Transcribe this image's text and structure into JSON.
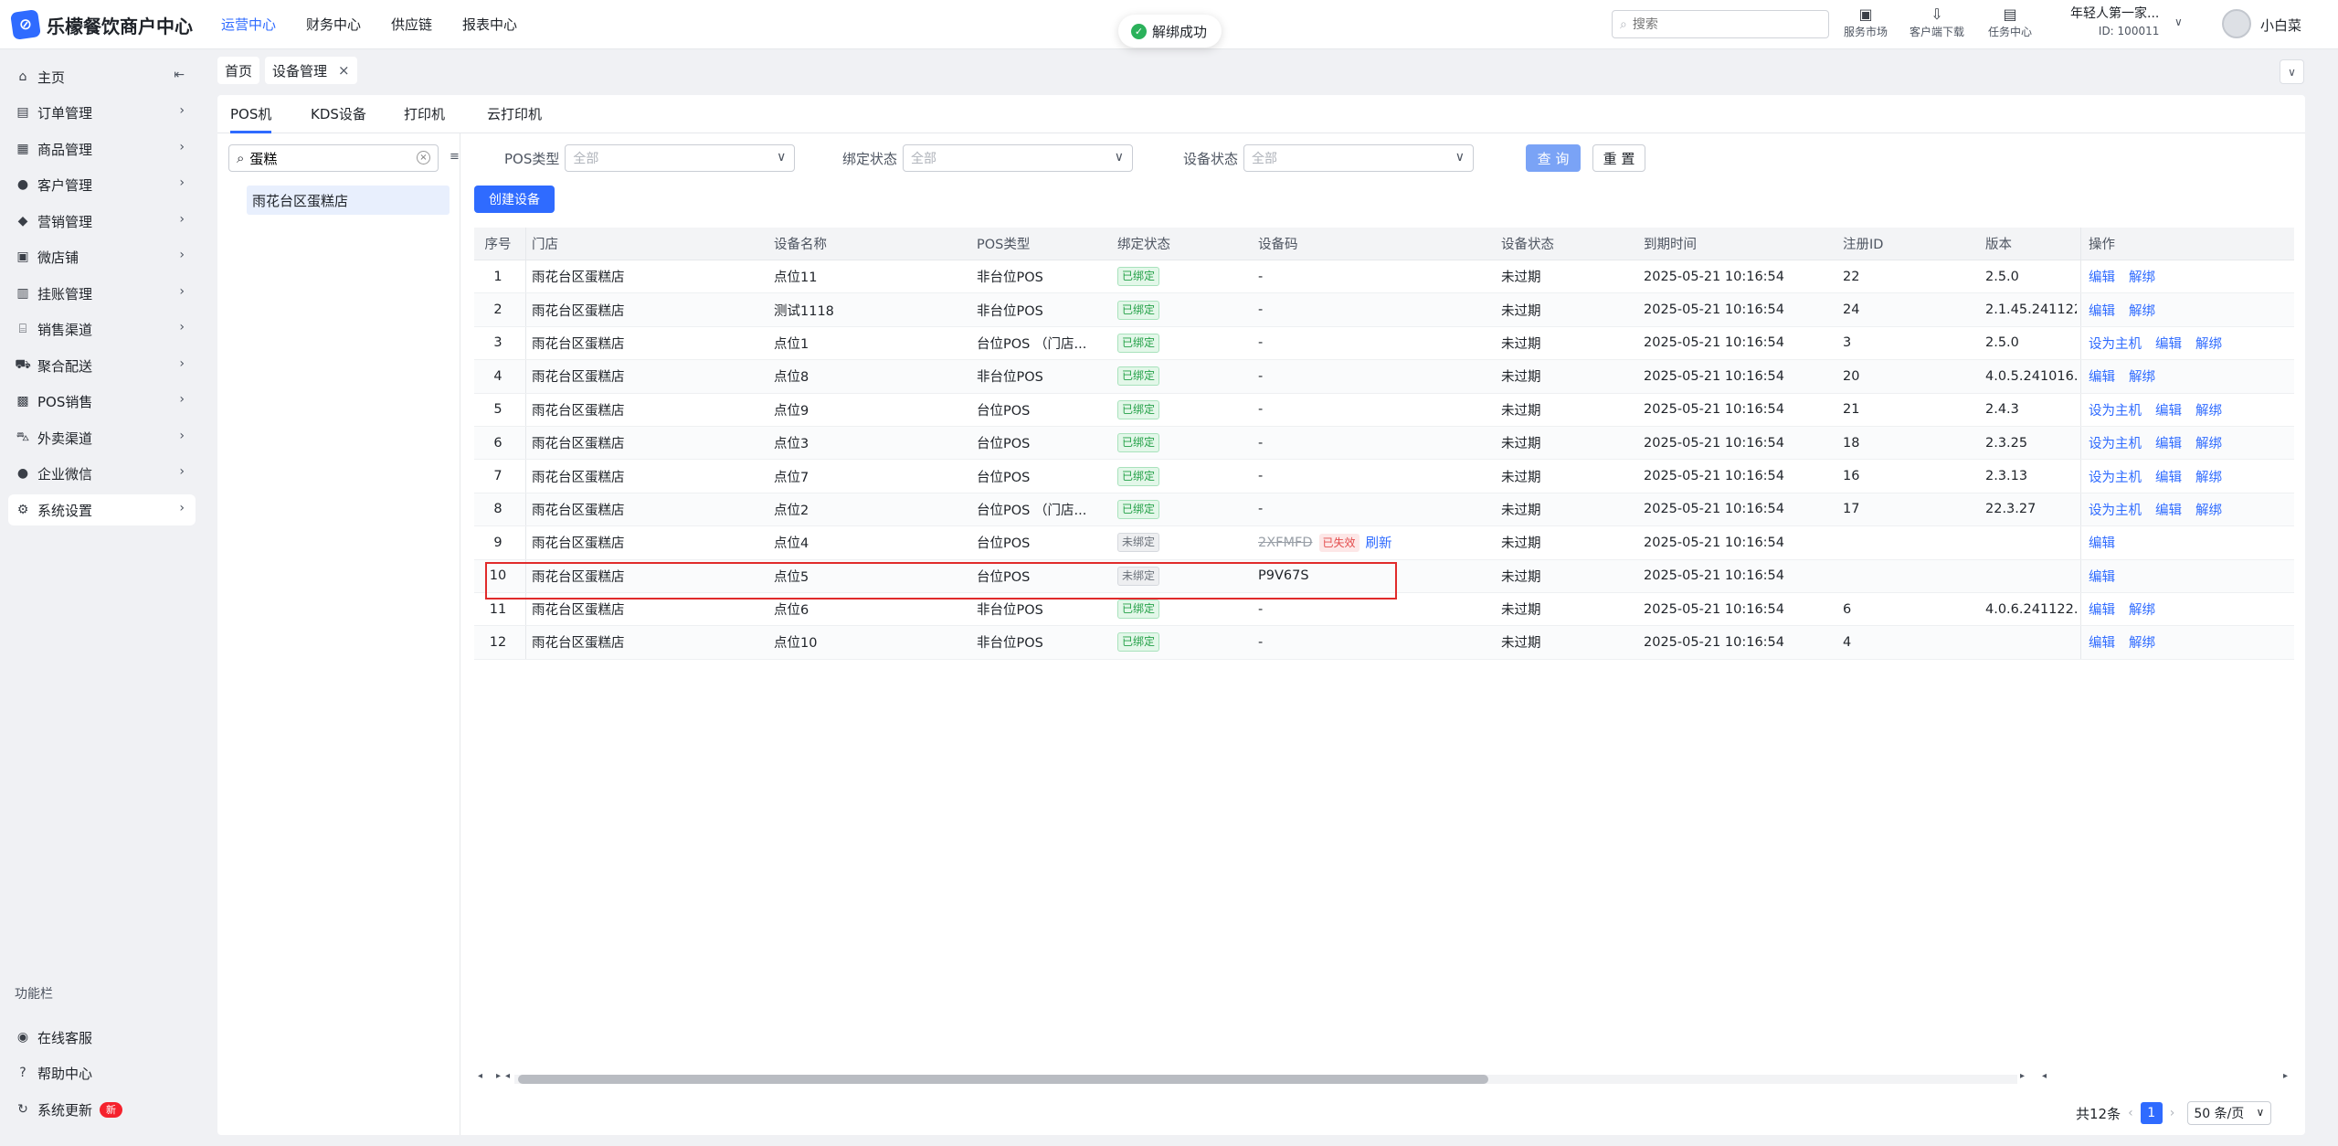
{
  "app": {
    "logo_glyph": "⊘",
    "name": "乐檬餐饮商户中心",
    "accent": "#2f6bff"
  },
  "topnav": [
    {
      "label": "运营中心",
      "active": true
    },
    {
      "label": "财务中心",
      "active": false
    },
    {
      "label": "供应链",
      "active": false
    },
    {
      "label": "报表中心",
      "active": false
    }
  ],
  "toast": {
    "message": "解绑成功",
    "icon": "check-circle-icon"
  },
  "top_search": {
    "placeholder": "搜索"
  },
  "tools": [
    {
      "label": "服务市场",
      "icon": "store-icon"
    },
    {
      "label": "客户端下载",
      "icon": "download-folder-icon"
    },
    {
      "label": "任务中心",
      "icon": "clipboard-icon"
    }
  ],
  "account": {
    "name": "年轻人第一家...",
    "id_text": "ID: 100011",
    "user": "小白菜"
  },
  "sidebar": {
    "items": [
      {
        "label": "主页",
        "icon": "home-icon"
      },
      {
        "label": "订单管理",
        "icon": "order-icon"
      },
      {
        "label": "商品管理",
        "icon": "goods-icon"
      },
      {
        "label": "客户管理",
        "icon": "user-icon"
      },
      {
        "label": "营销管理",
        "icon": "tag-icon"
      },
      {
        "label": "微店铺",
        "icon": "shop-icon"
      },
      {
        "label": "挂账管理",
        "icon": "ledger-icon"
      },
      {
        "label": "销售渠道",
        "icon": "bank-icon"
      },
      {
        "label": "聚合配送",
        "icon": "truck-icon"
      },
      {
        "label": "POS销售",
        "icon": "register-icon"
      },
      {
        "label": "外卖渠道",
        "icon": "scooter-icon"
      },
      {
        "label": "企业微信",
        "icon": "chat-icon"
      },
      {
        "label": "系统设置",
        "icon": "gear-icon"
      }
    ],
    "section_title": "功能栏",
    "bottom_items": [
      {
        "label": "在线客服",
        "icon": "eye-icon"
      },
      {
        "label": "帮助中心",
        "icon": "help-icon"
      },
      {
        "label": "系统更新",
        "icon": "refresh-icon",
        "badge": "新"
      }
    ]
  },
  "page_tabs": [
    {
      "label": "首页"
    },
    {
      "label": "设备管理",
      "close": "×"
    }
  ],
  "sub_tabs": [
    "POS机",
    "KDS设备",
    "打印机",
    "云打印机"
  ],
  "left_pane": {
    "search_value": "蛋糕",
    "fold_glyph": "≡",
    "store": "雨花台区蛋糕店"
  },
  "filters": {
    "pos_type": {
      "label": "POS类型",
      "value": "全部"
    },
    "bind_status": {
      "label": "绑定状态",
      "value": "全部"
    },
    "device_status": {
      "label": "设备状态",
      "value": "全部"
    },
    "query_label": "查 询",
    "reset_label": "重 置",
    "create_label": "创建设备"
  },
  "table": {
    "headers": [
      "序号",
      "门店",
      "设备名称",
      "POS类型",
      "绑定状态",
      "设备码",
      "设备状态",
      "到期时间",
      "注册ID",
      "版本",
      "操作"
    ],
    "rows": [
      {
        "no": "1",
        "store": "雨花台区蛋糕店",
        "name": "点位11",
        "type": "非台位POS",
        "bind": "已绑定",
        "code": "-",
        "status": "未过期",
        "expire": "2025-05-21 10:16:54",
        "reg": "22",
        "ver": "2.5.0",
        "ops": [
          "编辑",
          "解绑"
        ]
      },
      {
        "no": "2",
        "store": "雨花台区蛋糕店",
        "name": "测试1118",
        "type": "非台位POS",
        "bind": "已绑定",
        "code": "-",
        "status": "未过期",
        "expire": "2025-05-21 10:16:54",
        "reg": "24",
        "ver": "2.1.45.241122",
        "ops": [
          "编辑",
          "解绑"
        ]
      },
      {
        "no": "3",
        "store": "雨花台区蛋糕店",
        "name": "点位1",
        "type": "台位POS （门店...",
        "bind": "已绑定",
        "code": "-",
        "status": "未过期",
        "expire": "2025-05-21 10:16:54",
        "reg": "3",
        "ver": "2.5.0",
        "ops": [
          "设为主机",
          "编辑",
          "解绑"
        ]
      },
      {
        "no": "4",
        "store": "雨花台区蛋糕店",
        "name": "点位8",
        "type": "非台位POS",
        "bind": "已绑定",
        "code": "-",
        "status": "未过期",
        "expire": "2025-05-21 10:16:54",
        "reg": "20",
        "ver": "4.0.5.241016.",
        "ops": [
          "编辑",
          "解绑"
        ]
      },
      {
        "no": "5",
        "store": "雨花台区蛋糕店",
        "name": "点位9",
        "type": "台位POS",
        "bind": "已绑定",
        "code": "-",
        "status": "未过期",
        "expire": "2025-05-21 10:16:54",
        "reg": "21",
        "ver": "2.4.3",
        "ops": [
          "设为主机",
          "编辑",
          "解绑"
        ]
      },
      {
        "no": "6",
        "store": "雨花台区蛋糕店",
        "name": "点位3",
        "type": "台位POS",
        "bind": "已绑定",
        "code": "-",
        "status": "未过期",
        "expire": "2025-05-21 10:16:54",
        "reg": "18",
        "ver": "2.3.25",
        "ops": [
          "设为主机",
          "编辑",
          "解绑"
        ]
      },
      {
        "no": "7",
        "store": "雨花台区蛋糕店",
        "name": "点位7",
        "type": "台位POS",
        "bind": "已绑定",
        "code": "-",
        "status": "未过期",
        "expire": "2025-05-21 10:16:54",
        "reg": "16",
        "ver": "2.3.13",
        "ops": [
          "设为主机",
          "编辑",
          "解绑"
        ]
      },
      {
        "no": "8",
        "store": "雨花台区蛋糕店",
        "name": "点位2",
        "type": "台位POS （门店...",
        "bind": "已绑定",
        "code": "-",
        "status": "未过期",
        "expire": "2025-05-21 10:16:54",
        "reg": "17",
        "ver": "22.3.27",
        "ops": [
          "设为主机",
          "编辑",
          "解绑"
        ]
      },
      {
        "no": "9",
        "store": "雨花台区蛋糕店",
        "name": "点位4",
        "type": "台位POS",
        "bind": "未绑定",
        "code": "2XFMFD",
        "code_strike": true,
        "code_tag": "已失效",
        "code_link": "刷新",
        "status": "未过期",
        "expire": "2025-05-21 10:16:54",
        "reg": "",
        "ver": "",
        "ops": [
          "编辑"
        ]
      },
      {
        "no": "10",
        "store": "雨花台区蛋糕店",
        "name": "点位5",
        "type": "台位POS",
        "bind": "未绑定",
        "code": "P9V67S",
        "status": "未过期",
        "expire": "2025-05-21 10:16:54",
        "reg": "",
        "ver": "",
        "ops": [
          "编辑"
        ],
        "highlighted": true
      },
      {
        "no": "11",
        "store": "雨花台区蛋糕店",
        "name": "点位6",
        "type": "非台位POS",
        "bind": "已绑定",
        "code": "-",
        "status": "未过期",
        "expire": "2025-05-21 10:16:54",
        "reg": "6",
        "ver": "4.0.6.241122.",
        "ops": [
          "编辑",
          "解绑"
        ]
      },
      {
        "no": "12",
        "store": "雨花台区蛋糕店",
        "name": "点位10",
        "type": "非台位POS",
        "bind": "已绑定",
        "code": "-",
        "status": "未过期",
        "expire": "2025-05-21 10:16:54",
        "reg": "4",
        "ver": "",
        "ops": [
          "编辑",
          "解绑"
        ]
      }
    ]
  },
  "pagination": {
    "total": "共12条",
    "current": "1",
    "size": "50 条/页"
  }
}
